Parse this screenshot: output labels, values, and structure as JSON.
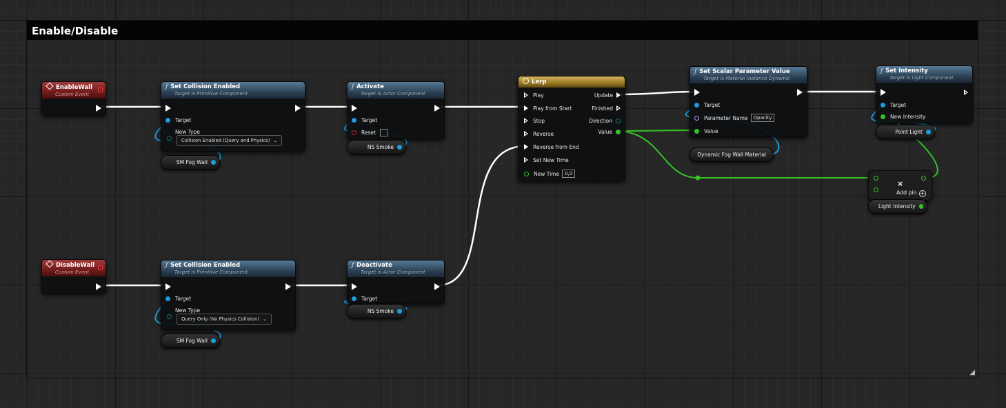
{
  "comment": {
    "title": "Enable/Disable"
  },
  "events": {
    "enable": {
      "title": "EnableWall",
      "subtitle": "Custom Event"
    },
    "disable": {
      "title": "DisableWall",
      "subtitle": "Custom Event"
    }
  },
  "set_collision_1": {
    "title": "Set Collision Enabled",
    "subtitle": "Target is Primitive Component",
    "target_label": "Target",
    "newtype_label": "New Type",
    "newtype_value": "Collision Enabled (Query and Physics)"
  },
  "set_collision_2": {
    "title": "Set Collision Enabled",
    "subtitle": "Target is Primitive Component",
    "target_label": "Target",
    "newtype_label": "New Type",
    "newtype_value": "Query Only (No Physics Collision)"
  },
  "activate": {
    "title": "Activate",
    "subtitle": "Target is Actor Component",
    "target_label": "Target",
    "reset_label": "Reset"
  },
  "deactivate": {
    "title": "Deactivate",
    "subtitle": "Target is Actor Component",
    "target_label": "Target"
  },
  "lerp": {
    "title": "Lerp",
    "inputs": [
      "Play",
      "Play from Start",
      "Stop",
      "Reverse",
      "Reverse from End",
      "Set New Time",
      "New Time"
    ],
    "new_time_value": "0,0",
    "outputs": [
      "Update",
      "Finished",
      "Direction",
      "Value"
    ]
  },
  "set_scalar": {
    "title": "Set Scalar Parameter Value",
    "subtitle": "Target is Material Instance Dynamic",
    "target_label": "Target",
    "param_label": "Parameter Name",
    "param_value": "Opacity",
    "value_label": "Value"
  },
  "set_intensity": {
    "title": "Set Intensity",
    "subtitle": "Target is Light Component",
    "target_label": "Target",
    "new_intensity_label": "New Intensity"
  },
  "add_node": {
    "add_pin_label": "Add pin"
  },
  "variables": {
    "sm_fog_wall_1": "SM Fog Wall",
    "sm_fog_wall_2": "SM Fog Wall",
    "ns_smoke_1": "NS Smoke",
    "ns_smoke_2": "NS Smoke",
    "dynamic_material": "Dynamic Fog Wall Material",
    "point_light": "Point Light",
    "light_intensity": "Light Intensity"
  },
  "colors": {
    "exec": "#ffffff",
    "float": "#33c426",
    "object": "#1a9ee0",
    "event_header": "#8b1f1f",
    "function_header": "#3a5870",
    "timeline_header": "#b8952e"
  }
}
